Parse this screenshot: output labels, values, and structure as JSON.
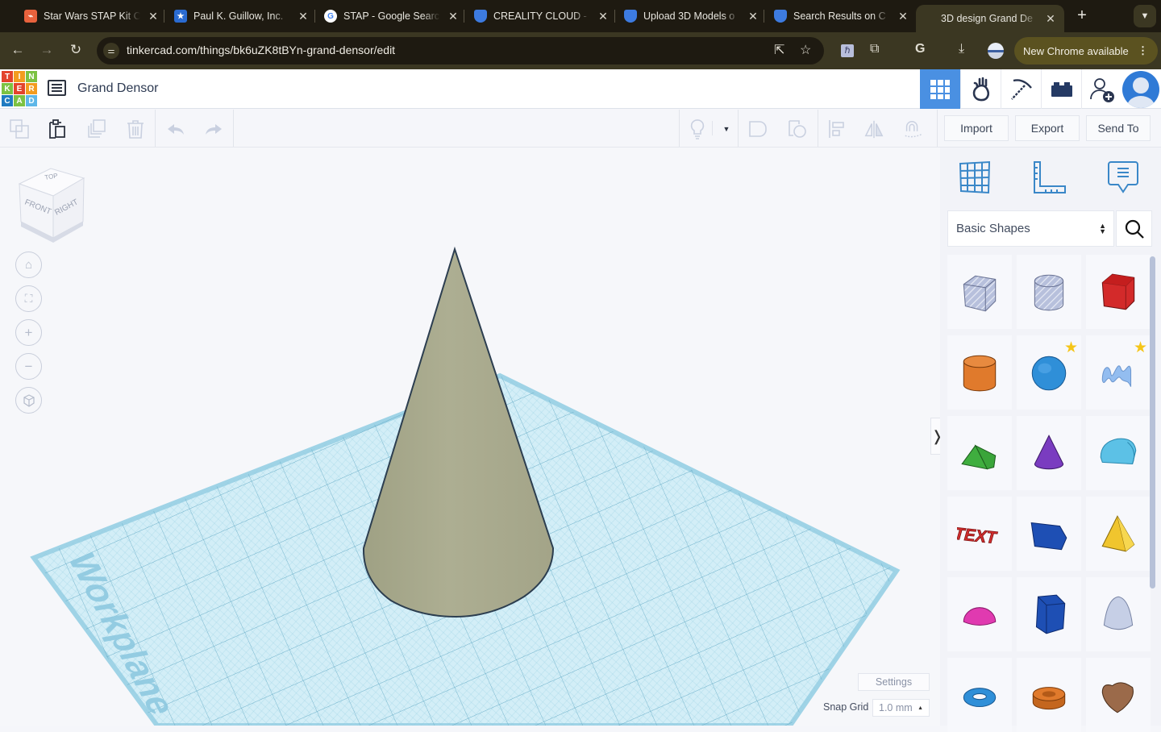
{
  "browser": {
    "tabs": [
      {
        "title": "Star Wars STAP Kit C",
        "favicon": "star-wars-favicon",
        "active": false
      },
      {
        "title": "Paul K. Guillow, Inc.",
        "favicon": "guillow-star-favicon",
        "active": false
      },
      {
        "title": "STAP - Google Search",
        "favicon": "google-favicon",
        "active": false
      },
      {
        "title": "CREALITY CLOUD - ",
        "favicon": "creality-favicon",
        "active": false
      },
      {
        "title": "Upload 3D Models o",
        "favicon": "creality-favicon",
        "active": false
      },
      {
        "title": "Search Results on C",
        "favicon": "creality-favicon",
        "active": false
      },
      {
        "title": "3D design Grand De",
        "favicon": "tinkercad-favicon",
        "active": true
      }
    ],
    "new_tab": "+",
    "tab_menu": "⌄",
    "url": "tinkercad.com/things/bk6uZK8tBYn-grand-densor/edit",
    "update_button": "New Chrome available",
    "icons": [
      "back-icon",
      "forward-icon",
      "reload-icon",
      "site-info-icon",
      "open-in-app-icon",
      "bookmark-star-icon",
      "extension-h-icon",
      "extensions-puzzle-icon",
      "google-g-icon",
      "download-icon",
      "profile-icon",
      "more-menu-icon"
    ]
  },
  "app": {
    "logo_letters": [
      "T",
      "I",
      "N",
      "K",
      "E",
      "R",
      "C",
      "A",
      "D"
    ],
    "logo_colors": [
      "#e3432c",
      "#f39c1f",
      "#7cc242",
      "#7cc242",
      "#e3432c",
      "#f39c1f",
      "#1f7bc1",
      "#7cc242",
      "#5eb7e8"
    ],
    "design_title": "Grand Densor",
    "accent_color": "#4a90e2",
    "header_icons": [
      "3d-design-grid-icon",
      "codeblocks-hand-icon",
      "minecraft-pickaxe-icon",
      "lego-brick-icon",
      "invite-user-icon",
      "user-avatar-icon"
    ]
  },
  "toolbar": {
    "import_label": "Import",
    "export_label": "Export",
    "send_to_label": "Send To"
  },
  "viewport": {
    "viewcube": {
      "top": "TOP",
      "front": "FRONT",
      "right": "RIGHT"
    },
    "workplane_label": "Workplane",
    "object": {
      "type": "cone",
      "color": "#a8a98c"
    },
    "settings_label": "Settings",
    "snap_grid_label": "Snap Grid",
    "snap_grid_value": "1.0 mm"
  },
  "panel": {
    "shape_category": "Basic Shapes",
    "shapes": [
      {
        "name": "Box Hole",
        "color": "#b7c0dc",
        "starred": false
      },
      {
        "name": "Cylinder Hole",
        "color": "#b7c0dc",
        "starred": false
      },
      {
        "name": "Box",
        "color": "#d32a2a",
        "starred": false
      },
      {
        "name": "Cylinder",
        "color": "#e07a2c",
        "starred": false
      },
      {
        "name": "Sphere",
        "color": "#2f8fd8",
        "starred": true
      },
      {
        "name": "Scribble",
        "color": "#93bdf0",
        "starred": true
      },
      {
        "name": "Roof",
        "color": "#3aa53a",
        "starred": false
      },
      {
        "name": "Cone",
        "color": "#7a3cc0",
        "starred": false
      },
      {
        "name": "Round Roof",
        "color": "#5cc1e6",
        "starred": false
      },
      {
        "name": "Text",
        "color": "#d22e2e",
        "starred": false
      },
      {
        "name": "Polygon",
        "color": "#1e4fb4",
        "starred": false
      },
      {
        "name": "Pyramid",
        "color": "#f0c52e",
        "starred": false
      },
      {
        "name": "Half Sphere",
        "color": "#e03ab0",
        "starred": false
      },
      {
        "name": "Polygon Prism",
        "color": "#1e4fb4",
        "starred": false
      },
      {
        "name": "Paraboloid",
        "color": "#c6cfe6",
        "starred": false
      },
      {
        "name": "Torus",
        "color": "#2f8fd8",
        "starred": false
      },
      {
        "name": "Tube",
        "color": "#e07a2c",
        "starred": false
      },
      {
        "name": "Heart",
        "color": "#9b6a4a",
        "starred": false
      }
    ]
  }
}
